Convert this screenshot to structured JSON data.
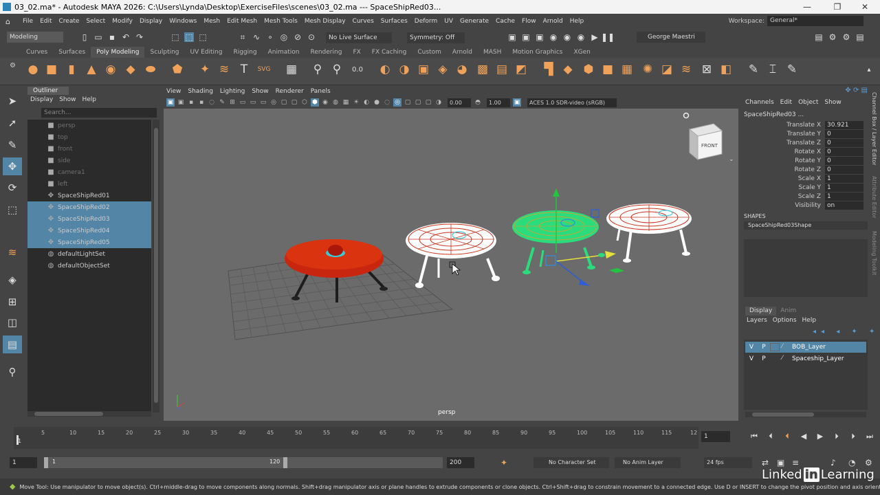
{
  "window": {
    "title": "03_02.ma* - Autodesk MAYA 2026: C:\\Users\\Lynda\\Desktop\\ExerciseFiles\\scenes\\03_02.ma  ---  SpaceShipRed03...",
    "controls": [
      "—",
      "❐",
      "✕"
    ]
  },
  "menubar": {
    "items": [
      "File",
      "Edit",
      "Create",
      "Select",
      "Modify",
      "Display",
      "Windows",
      "Mesh",
      "Edit Mesh",
      "Mesh Tools",
      "Mesh Display",
      "Curves",
      "Surfaces",
      "Deform",
      "UV",
      "Generate",
      "Cache",
      "Flow",
      "Arnold",
      "Help"
    ],
    "workspace_label": "Workspace:",
    "workspace_value": "General*"
  },
  "statusline": {
    "mode": "Modeling",
    "live_surface": "No Live Surface",
    "symmetry": "Symmetry: Off",
    "user": "George Maestri"
  },
  "shelf": {
    "tabs": [
      "Curves",
      "Surfaces",
      "Poly Modeling",
      "Sculpting",
      "UV Editing",
      "Rigging",
      "Animation",
      "Rendering",
      "FX",
      "FX Caching",
      "Custom",
      "Arnold",
      "MASH",
      "Motion Graphics",
      "XGen"
    ],
    "active_tab": "Poly Modeling"
  },
  "outliner": {
    "title": "Outliner",
    "menu": [
      "Display",
      "Show",
      "Help"
    ],
    "search_placeholder": "Search...",
    "items": [
      {
        "label": "persp",
        "icon": "camera-icon"
      },
      {
        "label": "top",
        "icon": "camera-icon"
      },
      {
        "label": "front",
        "icon": "camera-icon"
      },
      {
        "label": "side",
        "icon": "camera-icon"
      },
      {
        "label": "camera1",
        "icon": "camera-icon"
      },
      {
        "label": "left",
        "icon": "camera-icon"
      },
      {
        "label": "SpaceShipRed01",
        "icon": "transform-icon"
      },
      {
        "label": "SpaceShipRed02",
        "icon": "transform-icon"
      },
      {
        "label": "SpaceShipRed03",
        "icon": "transform-icon"
      },
      {
        "label": "SpaceShipRed04",
        "icon": "transform-icon"
      },
      {
        "label": "SpaceShipRed05",
        "icon": "transform-icon"
      },
      {
        "label": "defaultLightSet",
        "icon": "set-icon"
      },
      {
        "label": "defaultObjectSet",
        "icon": "set-icon"
      }
    ]
  },
  "viewport": {
    "menu": [
      "View",
      "Shading",
      "Lighting",
      "Show",
      "Renderer",
      "Panels"
    ],
    "exposure": "0.00",
    "gamma": "1.00",
    "color_management": "ACES 1.0 SDR-video (sRGB)",
    "view_cube_label": "FRONT",
    "camera_label": "persp"
  },
  "channelbox": {
    "menu": [
      "Channels",
      "Edit",
      "Object",
      "Show"
    ],
    "object_name": "SpaceShipRed03 ...",
    "attributes": [
      {
        "name": "Translate X",
        "value": "30.921"
      },
      {
        "name": "Translate Y",
        "value": "0"
      },
      {
        "name": "Translate Z",
        "value": "0"
      },
      {
        "name": "Rotate X",
        "value": "0"
      },
      {
        "name": "Rotate Y",
        "value": "0"
      },
      {
        "name": "Rotate Z",
        "value": "0"
      },
      {
        "name": "Scale X",
        "value": "1"
      },
      {
        "name": "Scale Y",
        "value": "1"
      },
      {
        "name": "Scale Z",
        "value": "1"
      },
      {
        "name": "Visibility",
        "value": "on"
      }
    ],
    "shapes_heading": "SHAPES",
    "shape_name": "SpaceShipRed03Shape",
    "side_tabs": [
      "Channel Box / Layer Editor",
      "Attribute Editor",
      "Modeling Toolkit"
    ]
  },
  "layer_editor": {
    "tabs": [
      "Display",
      "Anim"
    ],
    "menu": [
      "Layers",
      "Options",
      "Help"
    ],
    "layers": [
      {
        "v": "V",
        "p": "P",
        "name": "BOB_Layer"
      },
      {
        "v": "V",
        "p": "P",
        "name": "Spaceship_Layer"
      }
    ]
  },
  "timeslider": {
    "ticks": [
      "5",
      "10",
      "15",
      "20",
      "25",
      "30",
      "35",
      "40",
      "45",
      "50",
      "55",
      "60",
      "65",
      "70",
      "75",
      "80",
      "85",
      "90",
      "95",
      "100",
      "105",
      "110",
      "115",
      "12"
    ],
    "current_label": "1",
    "current_frame": "1"
  },
  "rangeslider": {
    "start": "1",
    "inner_start": "1",
    "inner_end": "120",
    "end": "200",
    "character_set": "No Character Set",
    "anim_layer": "No Anim Layer",
    "fps": "24 fps"
  },
  "helpline": {
    "text": "Move Tool: Use manipulator to move object(s). Ctrl+middle-drag to move components along normals. Shift+drag manipulator axis or plane handles to extrude components or clone objects. Ctrl+Shift+drag to constrain movement to a connected edge. Use D or INSERT to change the pivot position and axis orientation."
  },
  "watermark": {
    "linked": "Linked",
    "in": "in",
    "learning": "Learning"
  }
}
